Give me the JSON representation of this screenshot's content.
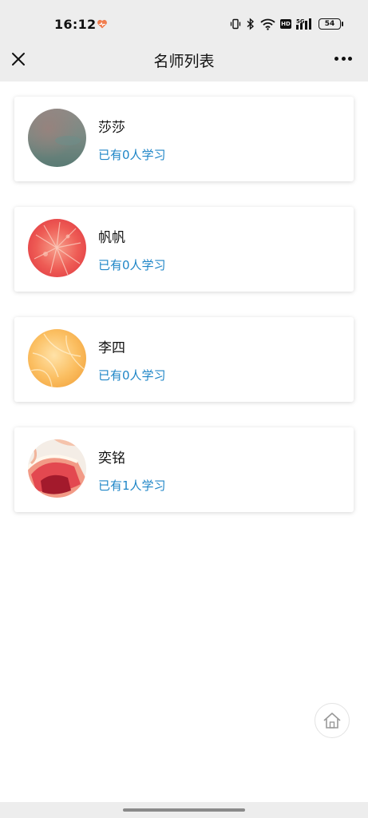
{
  "status_bar": {
    "time": "16:12",
    "battery": "54",
    "hd_label": "HD",
    "network_label": "5G"
  },
  "nav": {
    "title": "名师列表"
  },
  "teachers": [
    {
      "name": "莎莎",
      "students": "已有0人学习",
      "avatar": "gray-green-blur"
    },
    {
      "name": "帆帆",
      "students": "已有0人学习",
      "avatar": "grapefruit-red"
    },
    {
      "name": "李四",
      "students": "已有0人学习",
      "avatar": "orange-segment"
    },
    {
      "name": "奕铭",
      "students": "已有1人学习",
      "avatar": "grapefruit-slice"
    }
  ],
  "colors": {
    "accent": "#1f86c7",
    "navbar_bg": "#ededed"
  }
}
